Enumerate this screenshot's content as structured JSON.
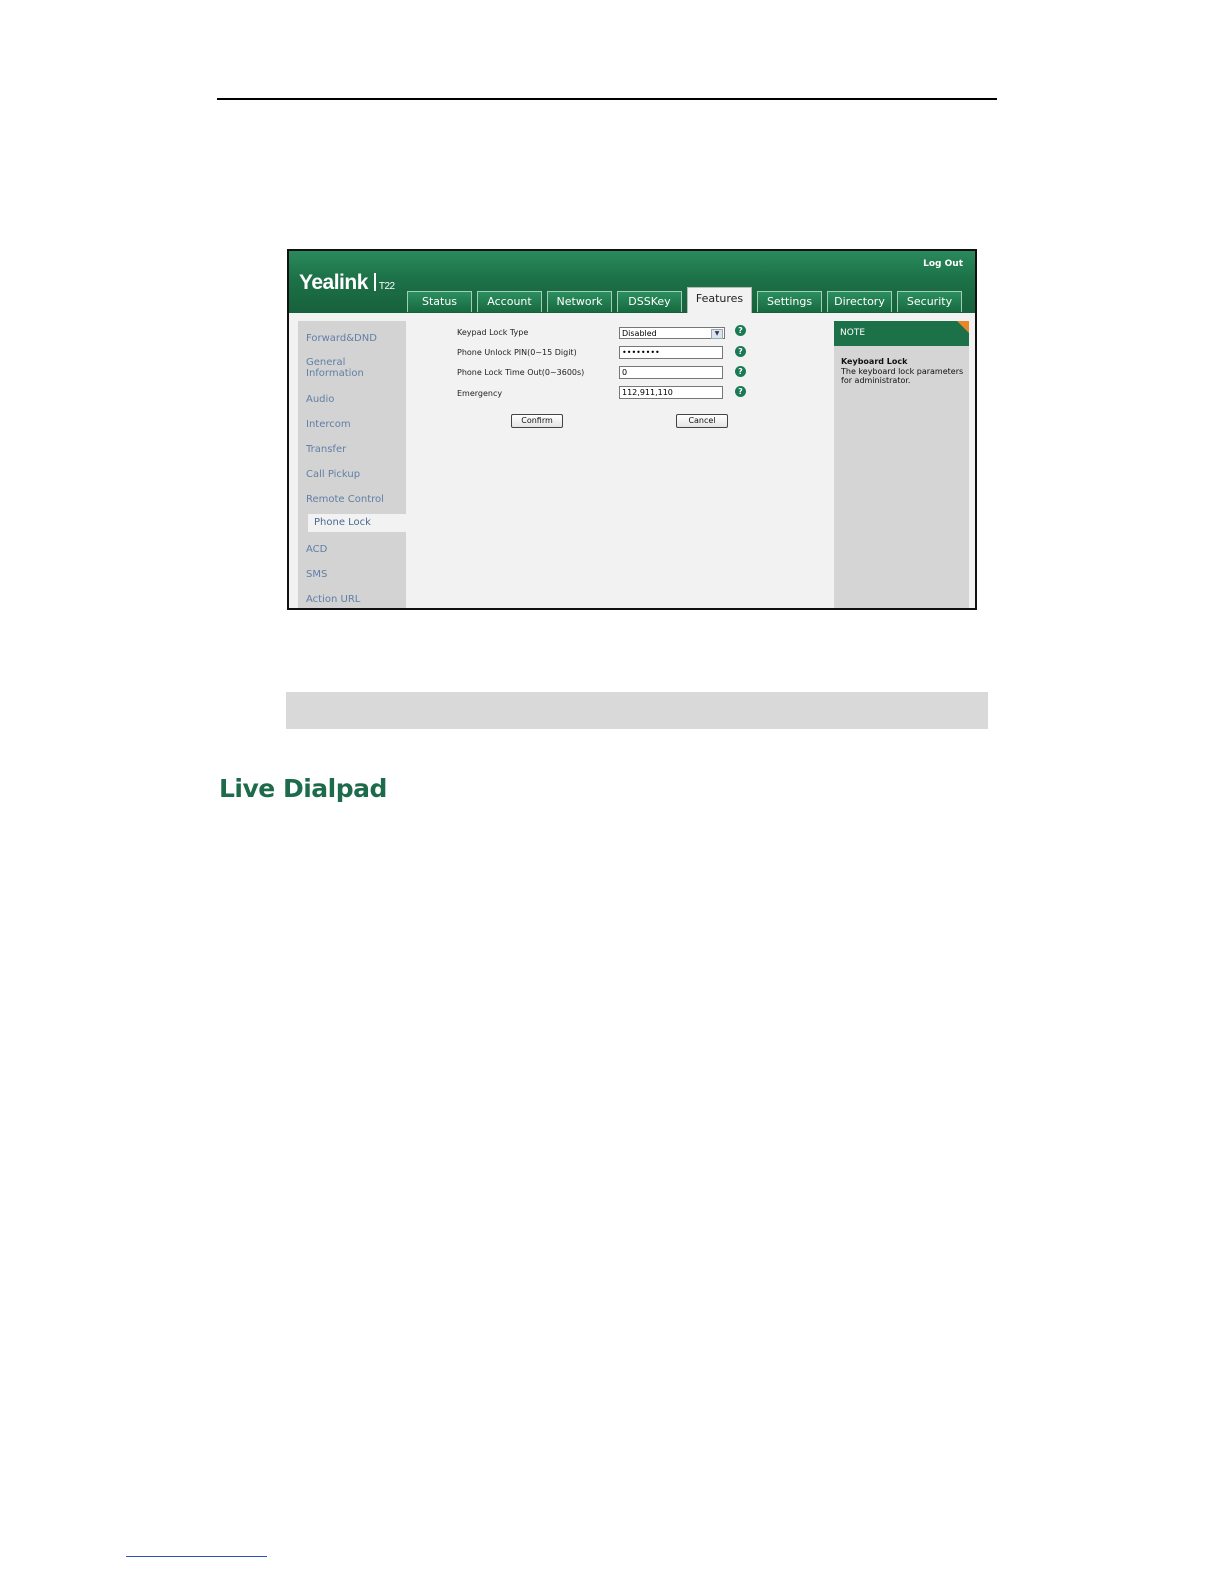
{
  "screenshot": {
    "brand": "Yealink",
    "model": "T22",
    "logout_label": "Log Out",
    "tabs": [
      "Status",
      "Account",
      "Network",
      "DSSKey",
      "Features",
      "Settings",
      "Directory",
      "Security"
    ],
    "active_tab": "Features",
    "sidebar": [
      "Forward&DND",
      "General Information",
      "Audio",
      "Intercom",
      "Transfer",
      "Call Pickup",
      "Remote Control",
      "Phone Lock",
      "ACD",
      "SMS",
      "Action URL"
    ],
    "active_sidebar": "Phone Lock",
    "form": {
      "keypad_lock_type_label": "Keypad Lock Type",
      "keypad_lock_type_value": "Disabled",
      "unlock_pin_label": "Phone Unlock PIN(0~15 Digit)",
      "unlock_pin_value": "••••••••",
      "timeout_label": "Phone Lock Time Out(0~3600s)",
      "timeout_value": "0",
      "emergency_label": "Emergency",
      "emergency_value": "112,911,110",
      "confirm_label": "Confirm",
      "cancel_label": "Cancel"
    },
    "note": {
      "heading": "NOTE",
      "title": "Keyboard Lock",
      "text": "The keyboard lock parameters for administrator."
    },
    "colors": {
      "brand_green": "#1d7148",
      "link_blue": "#5f7fa6",
      "note_corner": "#e8862a"
    }
  },
  "document": {
    "section_title": "Live Dialpad"
  }
}
